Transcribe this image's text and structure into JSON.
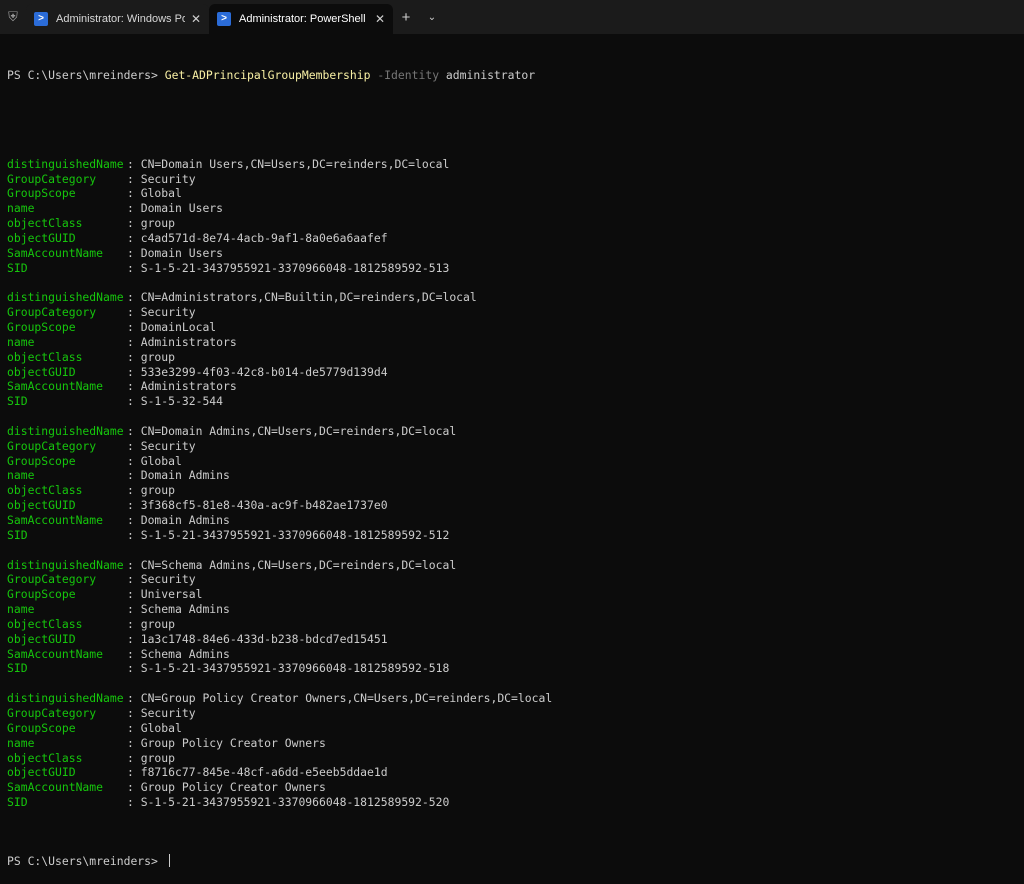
{
  "tabs": [
    {
      "title": "Administrator: Windows PowerShell",
      "active": false
    },
    {
      "title": "Administrator: PowerShell",
      "active": true
    }
  ],
  "terminal": {
    "prompt": "PS C:\\Users\\mreinders> ",
    "command": "Get-ADPrincipalGroupMembership",
    "param": "-Identity",
    "arg": "administrator",
    "final_prompt": "PS C:\\Users\\mreinders> ",
    "groups": [
      {
        "distinguishedName": "CN=Domain Users,CN=Users,DC=reinders,DC=local",
        "GroupCategory": "Security",
        "GroupScope": "Global",
        "name": "Domain Users",
        "objectClass": "group",
        "objectGUID": "c4ad571d-8e74-4acb-9af1-8a0e6a6aafef",
        "SamAccountName": "Domain Users",
        "SID": "S-1-5-21-3437955921-3370966048-1812589592-513"
      },
      {
        "distinguishedName": "CN=Administrators,CN=Builtin,DC=reinders,DC=local",
        "GroupCategory": "Security",
        "GroupScope": "DomainLocal",
        "name": "Administrators",
        "objectClass": "group",
        "objectGUID": "533e3299-4f03-42c8-b014-de5779d139d4",
        "SamAccountName": "Administrators",
        "SID": "S-1-5-32-544"
      },
      {
        "distinguishedName": "CN=Domain Admins,CN=Users,DC=reinders,DC=local",
        "GroupCategory": "Security",
        "GroupScope": "Global",
        "name": "Domain Admins",
        "objectClass": "group",
        "objectGUID": "3f368cf5-81e8-430a-ac9f-b482ae1737e0",
        "SamAccountName": "Domain Admins",
        "SID": "S-1-5-21-3437955921-3370966048-1812589592-512"
      },
      {
        "distinguishedName": "CN=Schema Admins,CN=Users,DC=reinders,DC=local",
        "GroupCategory": "Security",
        "GroupScope": "Universal",
        "name": "Schema Admins",
        "objectClass": "group",
        "objectGUID": "1a3c1748-84e6-433d-b238-bdcd7ed15451",
        "SamAccountName": "Schema Admins",
        "SID": "S-1-5-21-3437955921-3370966048-1812589592-518"
      },
      {
        "distinguishedName": "CN=Group Policy Creator Owners,CN=Users,DC=reinders,DC=local",
        "GroupCategory": "Security",
        "GroupScope": "Global",
        "name": "Group Policy Creator Owners",
        "objectClass": "group",
        "objectGUID": "f8716c77-845e-48cf-a6dd-e5eeb5ddae1d",
        "SamAccountName": "Group Policy Creator Owners",
        "SID": "S-1-5-21-3437955921-3370966048-1812589592-520"
      }
    ]
  },
  "colors": {
    "background": "#0c0c0c",
    "titlebar": "#1b1b1b",
    "property_name": "#16c60c",
    "command": "#f9f1a5",
    "parameter": "#767676",
    "text": "#cccccc"
  }
}
